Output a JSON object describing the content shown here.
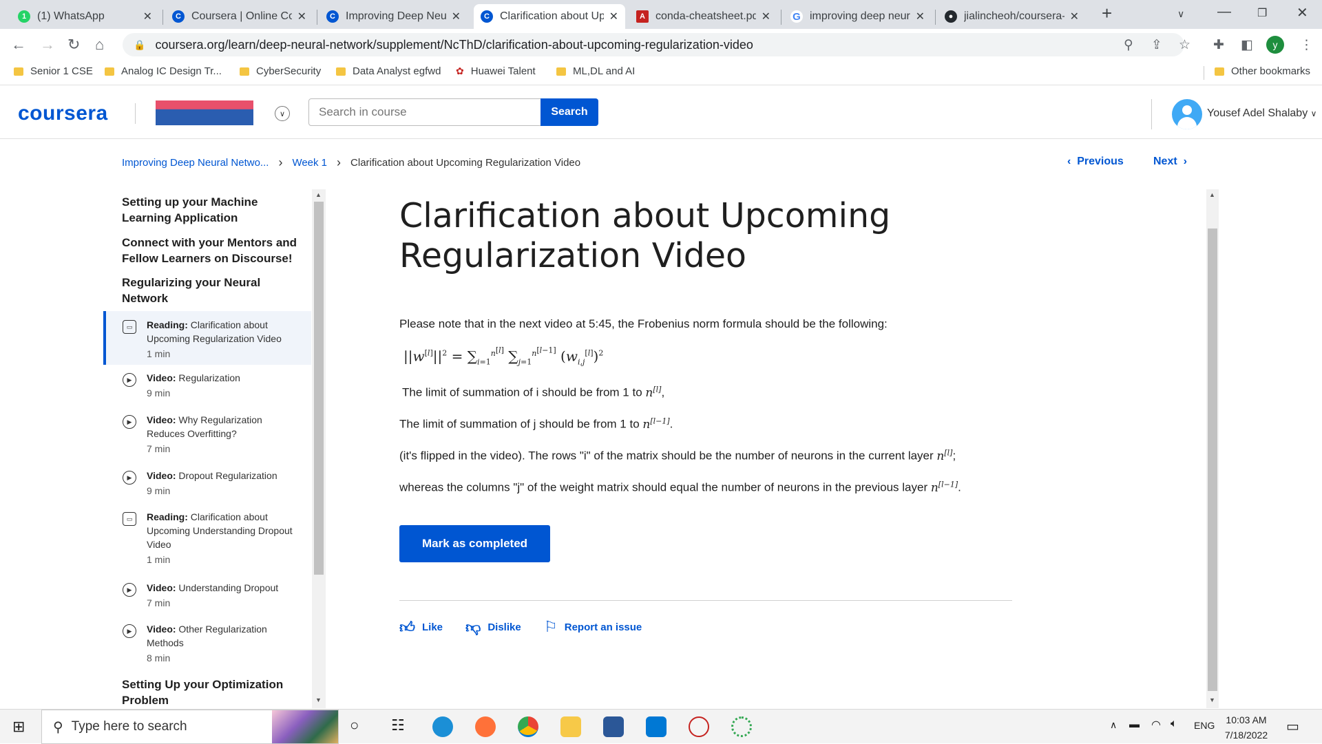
{
  "browser": {
    "tabs": [
      {
        "label": "(1) WhatsApp",
        "icon": "whatsapp-icon",
        "color": "#25d366",
        "active": false
      },
      {
        "label": "Coursera | Online Cou",
        "icon": "coursera-icon",
        "color": "#0056d2",
        "active": false
      },
      {
        "label": "Improving Deep Neur",
        "icon": "coursera-icon",
        "color": "#0056d2",
        "active": false
      },
      {
        "label": "Clarification about Up",
        "icon": "coursera-icon",
        "color": "#0056d2",
        "active": true
      },
      {
        "label": "conda-cheatsheet.pdf",
        "icon": "pdf-icon",
        "color": "#c5221f",
        "active": false
      },
      {
        "label": "improving deep neur",
        "icon": "google-icon",
        "color": "#4285f4",
        "active": false
      },
      {
        "label": "jialincheoh/coursera-",
        "icon": "github-icon",
        "color": "#24292e",
        "active": false
      }
    ],
    "url": "coursera.org/learn/deep-neural-network/supplement/NcThD/clarification-about-upcoming-regularization-video",
    "profile_initial": "y",
    "bookmarks": [
      "Senior 1 CSE",
      "Analog IC Design Tr...",
      "CyberSecurity",
      "Data Analyst egfwd",
      "Huawei Talent",
      "ML,DL and AI"
    ],
    "other_bookmarks": "Other bookmarks"
  },
  "header": {
    "logo": "coursera",
    "search_placeholder": "Search in course",
    "search_button": "Search",
    "user_name": "Yousef Adel Shalaby"
  },
  "breadcrumb": {
    "course": "Improving Deep Neural Netwo...",
    "week": "Week 1",
    "current": "Clarification about Upcoming Regularization Video"
  },
  "nav": {
    "previous": "Previous",
    "next": "Next"
  },
  "sidebar": {
    "sections": [
      "Setting up your Machine Learning Application",
      "Connect with your Mentors and Fellow Learners on Discourse!",
      "Regularizing your Neural Network",
      "Setting Up your Optimization Problem"
    ],
    "items": [
      {
        "type": "Reading:",
        "title": "Clarification about Upcoming Regularization Video",
        "duration": "1 min",
        "icon": "reading-icon",
        "active": true
      },
      {
        "type": "Video:",
        "title": "Regularization",
        "duration": "9 min",
        "icon": "play-icon",
        "active": false
      },
      {
        "type": "Video:",
        "title": "Why Regularization Reduces Overfitting?",
        "duration": "7 min",
        "icon": "play-icon",
        "active": false
      },
      {
        "type": "Video:",
        "title": "Dropout Regularization",
        "duration": "9 min",
        "icon": "play-icon",
        "active": false
      },
      {
        "type": "Reading:",
        "title": "Clarification about Upcoming Understanding Dropout Video",
        "duration": "1 min",
        "icon": "reading-icon",
        "active": false
      },
      {
        "type": "Video:",
        "title": "Understanding Dropout",
        "duration": "7 min",
        "icon": "play-icon",
        "active": false
      },
      {
        "type": "Video:",
        "title": "Other Regularization Methods",
        "duration": "8 min",
        "icon": "play-icon",
        "active": false
      }
    ]
  },
  "main": {
    "title": "Clarification about Upcoming Regularization Video",
    "intro": "Please note that in the next video at 5:45, the Frobenius norm formula should be the following:",
    "line_i": "The limit of summation of i should be from 1 to",
    "line_j": "The limit of summation of j should be from 1 to",
    "line_flip": "(it's flipped in the video).    The rows \"i\" of the matrix should be the number of neurons in the current layer",
    "line_cols": "whereas the columns \"j\" of the weight matrix should equal the number of neurons in the previous layer",
    "mark_button": "Mark as completed",
    "like": "Like",
    "dislike": "Dislike",
    "report": "Report an issue"
  },
  "taskbar": {
    "search_placeholder": "Type here to search",
    "language": "ENG",
    "time": "10:03 AM",
    "date": "7/18/2022"
  }
}
